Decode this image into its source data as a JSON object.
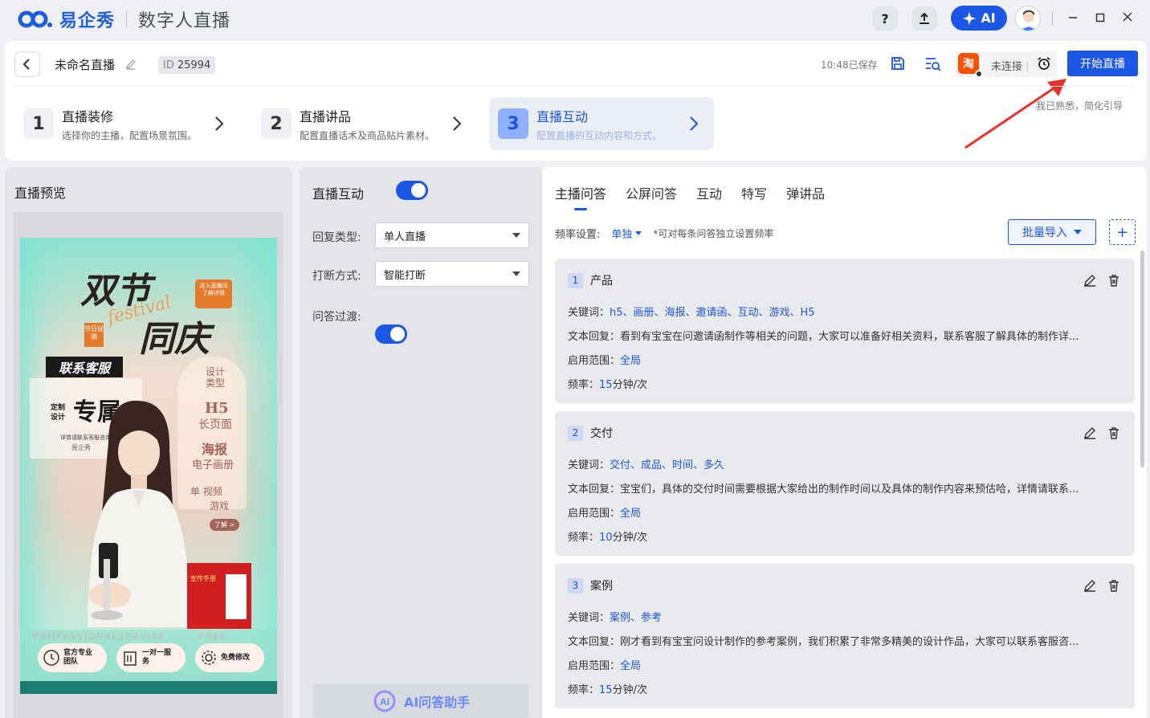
{
  "titlebar": {
    "brand": "易企秀",
    "product": "数字人直播",
    "help": "?",
    "ai_label": "AI"
  },
  "header": {
    "doc_name": "未命名直播",
    "id_key": "ID",
    "id_value": "25994",
    "saved_status": "10:48已保存",
    "connection_status": "未连接",
    "platform_icon_text": "淘",
    "start_button": "开始直播",
    "hint": "我已熟悉，简化引导"
  },
  "steps": [
    {
      "num": "1",
      "title": "直播装修",
      "desc": "选择你的主播，配置场景氛围。"
    },
    {
      "num": "2",
      "title": "直播讲品",
      "desc": "配置直播话术及商品贴片素材。"
    },
    {
      "num": "3",
      "title": "直播互动",
      "desc": "配置直播的互动内容和方式。"
    }
  ],
  "preview": {
    "title": "直播预览",
    "poster": {
      "headline1": "双节",
      "headline2": "同庆",
      "script": "festival",
      "badge_top": "进入直播间了解详情",
      "badge_tag": "节日促销",
      "service": "联系客服",
      "exclusive": "专属",
      "custom": "定制设计",
      "consult": "详情请联系客服咨询",
      "logo": "易企秀",
      "cat_title": "设计类型",
      "cat1": "H5",
      "cat1b": "长页面",
      "cat2": "海报",
      "cat2b": "电子画册",
      "cat3": "单 视频",
      "cat3b": "游戏",
      "more": "了解 >",
      "book_title": "宣传手册",
      "eng": [
        "PROFESSIONAL",
        "SERVICE",
        "FREE"
      ],
      "feat": [
        "官方专业团队",
        "一对一服务",
        "免费修改"
      ]
    }
  },
  "settings": {
    "interact_label": "直播互动",
    "reply_type_label": "回复类型:",
    "reply_type_value": "单人直播",
    "interrupt_label": "打断方式:",
    "interrupt_value": "智能打断",
    "transition_label": "问答过渡:",
    "ai_helper": "AI问答助手"
  },
  "tabs": [
    "主播问答",
    "公屏问答",
    "互动",
    "特写",
    "弹讲品"
  ],
  "freq": {
    "label": "频率设置:",
    "value": "单独",
    "note": "*可对每条问答独立设置频率"
  },
  "batch_import": "批量导入",
  "qa_labels": {
    "keywords": "关键词：",
    "reply": "文本回复：",
    "scope": "启用范围：",
    "rate": "频率："
  },
  "qa_items": [
    {
      "num": "1",
      "title": "产品",
      "keywords": "h5、画册、海报、邀请函、互动、游戏、H5",
      "reply": "看到有宝宝在问邀请函制作等相关的问题，大家可以准备好相关资料，联系客服了解具体的制作详...",
      "scope": "全局",
      "rate_num": "15",
      "rate_unit": "分钟/次"
    },
    {
      "num": "2",
      "title": "交付",
      "keywords": "交付、成品、时间、多久",
      "reply": "宝宝们，具体的交付时间需要根据大家给出的制作时间以及具体的制作内容来预估哈，详情请联系...",
      "scope": "全局",
      "rate_num": "10",
      "rate_unit": "分钟/次"
    },
    {
      "num": "3",
      "title": "案例",
      "keywords": "案例、参考",
      "reply": "刚才看到有宝宝问设计制作的参考案例，我们积累了非常多精美的设计作品，大家可以联系客服咨...",
      "scope": "全局",
      "rate_num": "15",
      "rate_unit": "分钟/次"
    }
  ],
  "colors": {
    "accent": "#1b56e6",
    "taobao": "#ff5000"
  }
}
